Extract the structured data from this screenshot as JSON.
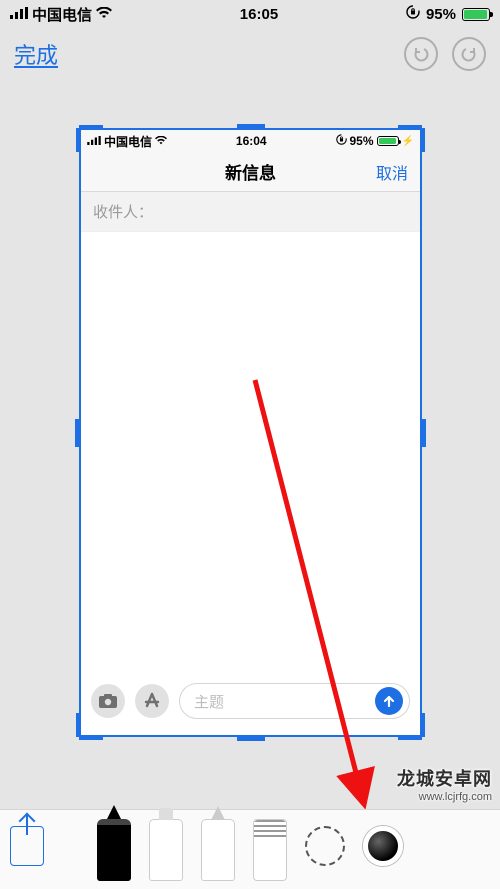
{
  "outer_status": {
    "carrier": "中国电信",
    "time": "16:05",
    "battery_percent": "95%",
    "battery_fill_pct": 95
  },
  "outer_nav": {
    "done_label": "完成",
    "undo_icon": "undo-icon",
    "redo_icon": "redo-icon"
  },
  "inner_status": {
    "carrier": "中国电信",
    "time": "16:04",
    "battery_percent": "95%",
    "battery_fill_pct": 95
  },
  "inner_nav": {
    "title": "新信息",
    "cancel_label": "取消"
  },
  "inner_recipient_label": "收件人：",
  "inner_subject_placeholder": "主题",
  "toolbar": {
    "share": "share-icon",
    "tools": [
      "pen",
      "marker",
      "pencil",
      "eraser",
      "lasso",
      "color"
    ]
  },
  "watermark": {
    "line1": "龙城安卓网",
    "line2": "www.lcjrfg.com"
  },
  "annotation": {
    "color": "#e11",
    "from_note": "upper screenshot area",
    "to_note": "color tool in toolbar"
  }
}
